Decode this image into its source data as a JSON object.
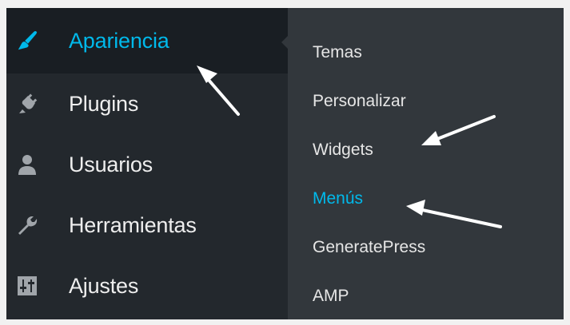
{
  "sidebar": {
    "items": [
      {
        "label": "Apariencia",
        "icon": "paintbrush-icon",
        "active": true
      },
      {
        "label": "Plugins",
        "icon": "plug-icon"
      },
      {
        "label": "Usuarios",
        "icon": "user-icon"
      },
      {
        "label": "Herramientas",
        "icon": "wrench-icon"
      },
      {
        "label": "Ajustes",
        "icon": "sliders-icon"
      }
    ]
  },
  "submenu": {
    "items": [
      {
        "label": "Temas"
      },
      {
        "label": "Personalizar"
      },
      {
        "label": "Widgets"
      },
      {
        "label": "Menús",
        "current": true
      },
      {
        "label": "GeneratePress"
      },
      {
        "label": "AMP"
      }
    ]
  },
  "colors": {
    "sidebar_bg": "#23282d",
    "submenu_bg": "#32373c",
    "active_bg": "#191e23",
    "accent": "#00b9eb",
    "icon": "#a0a5aa",
    "annotation_arrow": "#ffffff"
  }
}
